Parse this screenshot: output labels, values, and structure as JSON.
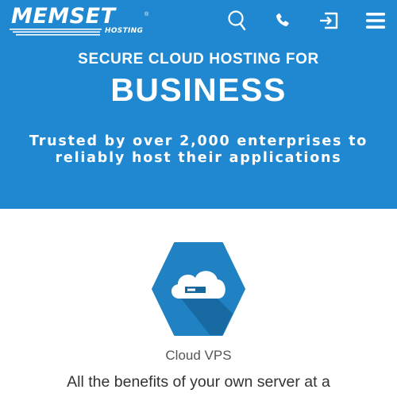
{
  "header": {
    "logo": {
      "main": "MEMSET",
      "registered": "®",
      "sub": "HOSTING"
    },
    "icons": [
      "search-icon",
      "phone-icon",
      "login-icon",
      "menu-icon"
    ]
  },
  "hero": {
    "kicker": "SECURE CLOUD HOSTING FOR",
    "title": "BUSINESS",
    "subtitle": "Trusted by over 2,000 enterprises to reliably host their applications"
  },
  "feature": {
    "icon": "cloud-server-icon",
    "label": "Cloud VPS",
    "description": "All the benefits of your own server at a"
  },
  "colors": {
    "brand_blue": "#1f88d1",
    "icon_hex": "#2081c3",
    "icon_shadow": "#17669c",
    "text_gray": "#555555"
  }
}
